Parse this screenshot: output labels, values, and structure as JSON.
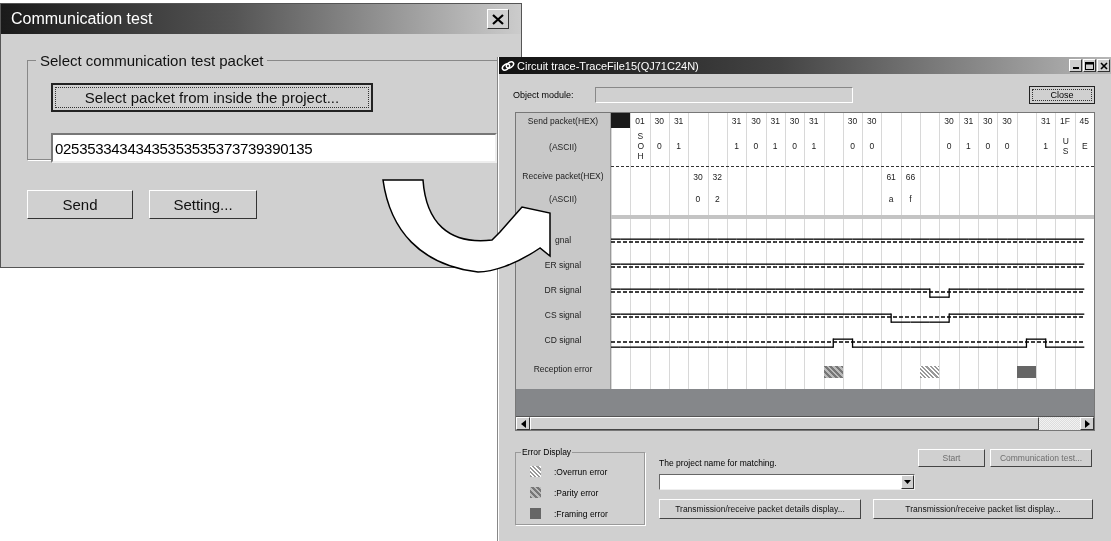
{
  "dialog": {
    "title": "Communication test",
    "group_label": "Select communication test packet",
    "select_button": "Select packet from inside the project...",
    "packet_value": "02535334343435353535373739390135",
    "buttons": [
      "Send",
      "Setting..."
    ]
  },
  "trace": {
    "title": "Circuit trace-TraceFile15(QJ71C24N)",
    "object_module_label": "Object module:",
    "close_button": "Close",
    "row_labels": {
      "send_hex": "Send packet(HEX)",
      "send_ascii": "(ASCII)",
      "receive_hex": "Receive packet(HEX)",
      "receive_ascii": "(ASCII)"
    },
    "columns": [
      {
        "highlighted": true
      },
      {
        "highlighted": false,
        "send_hex": "01",
        "send_ascii": "SOH"
      },
      {
        "highlighted": false,
        "send_hex": "30",
        "send_ascii": "0"
      },
      {
        "highlighted": false,
        "send_hex": "31",
        "send_ascii": "1"
      },
      {
        "highlighted": false,
        "receive_hex": "30",
        "receive_ascii": "0"
      },
      {
        "highlighted": false,
        "receive_hex": "32",
        "receive_ascii": "2"
      },
      {
        "highlighted": false,
        "send_hex": "31",
        "send_ascii": "1"
      },
      {
        "highlighted": false,
        "send_hex": "30",
        "send_ascii": "0"
      },
      {
        "highlighted": false,
        "send_hex": "31",
        "send_ascii": "1"
      },
      {
        "highlighted": false,
        "send_hex": "30",
        "send_ascii": "0"
      },
      {
        "highlighted": false,
        "send_hex": "31",
        "send_ascii": "1"
      },
      {
        "highlighted": false,
        "kind": "parity"
      },
      {
        "highlighted": false,
        "send_hex": "30",
        "send_ascii": "0"
      },
      {
        "highlighted": false,
        "send_hex": "30",
        "send_ascii": "0"
      },
      {
        "highlighted": false,
        "receive_hex": "61",
        "receive_ascii": "a"
      },
      {
        "highlighted": false,
        "receive_hex": "66",
        "receive_ascii": "f"
      },
      {
        "highlighted": false,
        "kind": "overrun"
      },
      {
        "highlighted": false,
        "send_hex": "30",
        "send_ascii": "0"
      },
      {
        "highlighted": false,
        "send_hex": "31",
        "send_ascii": "1"
      },
      {
        "highlighted": false,
        "send_hex": "30",
        "send_ascii": "0"
      },
      {
        "highlighted": false,
        "send_hex": "30",
        "send_ascii": "0"
      },
      {
        "highlighted": false,
        "kind": "framing"
      },
      {
        "highlighted": false,
        "send_hex": "31",
        "send_ascii": "1"
      },
      {
        "highlighted": false,
        "send_hex": "1F",
        "send_ascii": "US"
      },
      {
        "highlighted": false,
        "send_hex": "45",
        "send_ascii": "E"
      }
    ],
    "signals": [
      {
        "label": "gnal",
        "high": [
          true,
          true,
          true,
          true,
          true,
          true,
          true,
          true,
          true,
          true,
          true,
          true,
          true,
          true,
          true,
          true,
          true,
          true,
          true,
          true,
          true,
          true,
          true,
          true,
          true
        ]
      },
      {
        "label": "ER signal",
        "high": [
          true,
          true,
          true,
          true,
          true,
          true,
          true,
          true,
          true,
          true,
          true,
          true,
          true,
          true,
          true,
          true,
          true,
          true,
          true,
          true,
          true,
          true,
          true,
          true,
          true
        ]
      },
      {
        "label": "DR signal",
        "high": [
          true,
          true,
          true,
          true,
          true,
          true,
          true,
          true,
          true,
          true,
          true,
          true,
          true,
          true,
          true,
          true,
          true,
          false,
          true,
          true,
          true,
          true,
          true,
          true,
          true
        ]
      },
      {
        "label": "CS signal",
        "high": [
          true,
          true,
          true,
          true,
          true,
          true,
          true,
          true,
          true,
          true,
          true,
          true,
          true,
          true,
          true,
          false,
          false,
          false,
          true,
          true,
          true,
          true,
          true,
          true,
          true
        ]
      },
      {
        "label": "CD signal",
        "high": [
          false,
          false,
          false,
          false,
          false,
          false,
          false,
          false,
          false,
          false,
          false,
          false,
          true,
          false,
          false,
          false,
          false,
          false,
          false,
          false,
          false,
          false,
          true,
          false,
          false
        ]
      }
    ],
    "reception_error_label": "Reception error",
    "error_display": {
      "title": "Error Display",
      "items": [
        {
          "kind": "overrun",
          "label": ":Overrun error"
        },
        {
          "kind": "parity",
          "label": ":Parity error"
        },
        {
          "kind": "framing",
          "label": ":Framing error"
        }
      ]
    },
    "matching_label": "The project name for matching.",
    "start_button": {
      "label": "Start",
      "disabled": true
    },
    "communication_test_button": {
      "label": "Communication test...",
      "disabled": true
    },
    "details_button": "Transmission/receive packet details display...",
    "list_button": "Transmission/receive packet list display..."
  }
}
